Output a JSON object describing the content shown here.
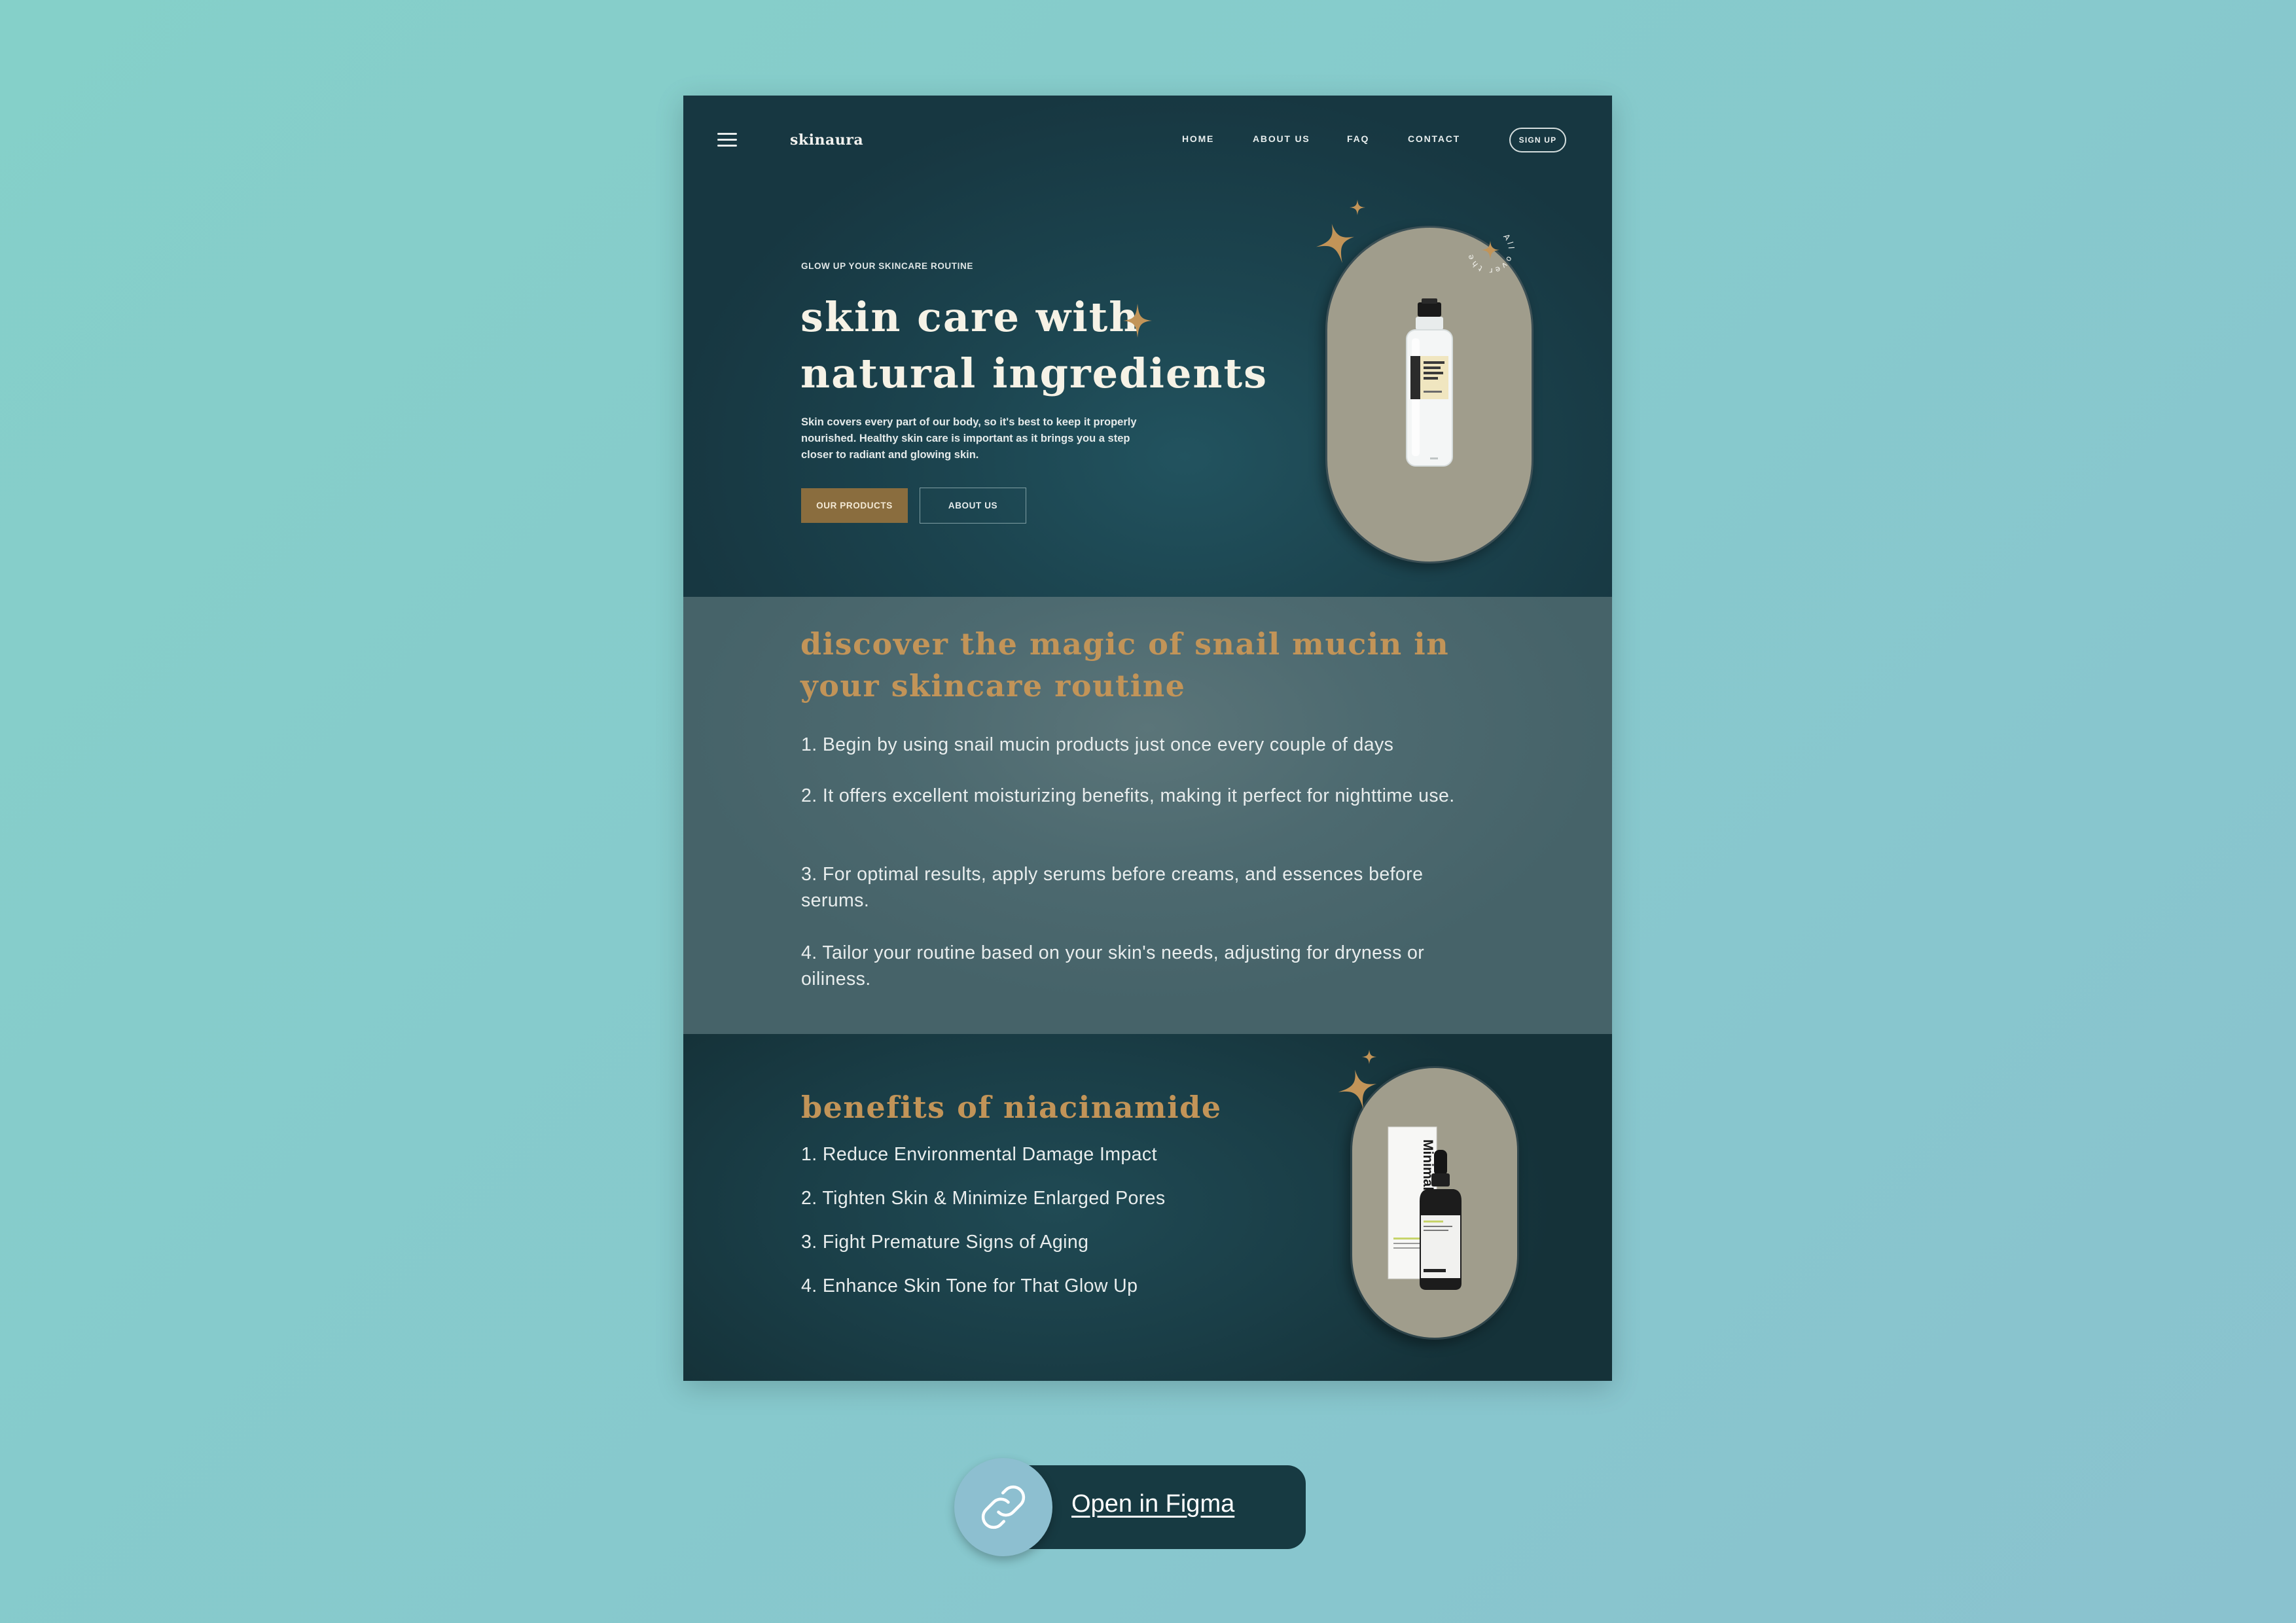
{
  "brand": {
    "logo": "skinaura"
  },
  "nav": {
    "items": [
      "HOME",
      "ABOUT US",
      "FAQ",
      "CONTACT"
    ],
    "signup_label": "SIGN UP"
  },
  "hero": {
    "eyebrow": "GLOW UP YOUR SKINCARE ROUTINE",
    "title_line1": "skin care with",
    "title_line2": "natural ingredients",
    "description": "Skin covers every part of our body, so it's best to keep it properly nourished. Healthy skin care is important as it brings you a step closer to radiant and glowing skin.",
    "primary_button": "OUR PRODUCTS",
    "secondary_button": "ABOUT US",
    "circular_text": "All over the world",
    "product_image": "serum-bottle-image"
  },
  "mucin": {
    "title": "discover the magic of snail mucin in your skincare routine",
    "items": [
      "1. Begin by using snail mucin products just once every couple of days",
      "2. It offers excellent moisturizing benefits, making it perfect for nighttime use.",
      "3. For optimal results, apply serums before creams, and essences before serums.",
      "4. Tailor your routine based on your skin's needs, adjusting for dryness or oiliness."
    ]
  },
  "niacinamide": {
    "title": "benefits of niacinamide",
    "items": [
      "1. Reduce Environmental Damage Impact",
      "2. Tighten Skin & Minimize Enlarged Pores",
      "3. Fight Premature Signs of Aging",
      "4. Enhance Skin Tone for That Glow Up"
    ],
    "product_brand": "Minimalist"
  },
  "figma": {
    "label": "Open in Figma",
    "icon": "link-icon"
  },
  "colors": {
    "background": "#87cccc",
    "hero_bg": "#1c4550",
    "mucin_bg": "#4d6a70",
    "accent_gold": "#c29458",
    "button_gold": "#8a6d3e",
    "pill_bg": "#a09d8c"
  }
}
